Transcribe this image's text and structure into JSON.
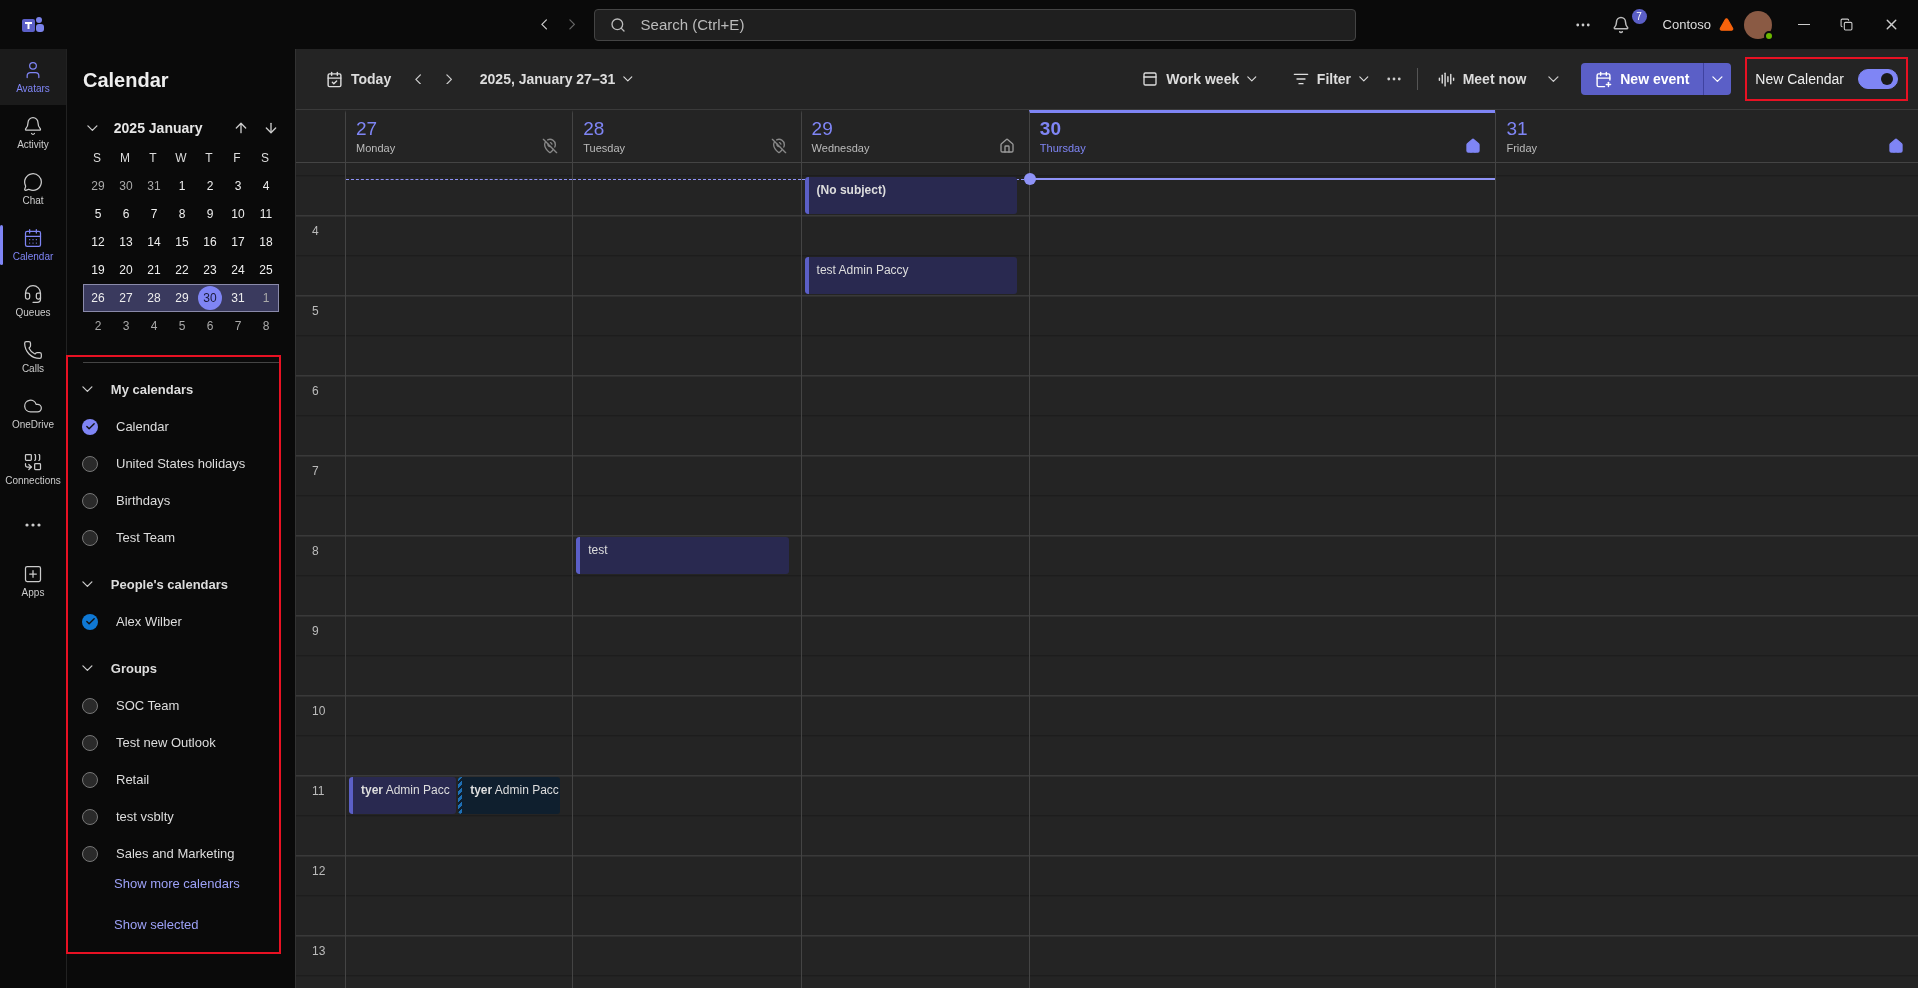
{
  "app_bar": {
    "search": {
      "placeholder": "Search (Ctrl+E)"
    },
    "notifications": {
      "badge": "7"
    },
    "org": "Contoso",
    "org_warning": true
  },
  "rail": [
    {
      "label": "Avatars",
      "selected": false,
      "highlighted": true
    },
    {
      "label": "Activity",
      "selected": false,
      "highlighted": false
    },
    {
      "label": "Chat",
      "selected": false,
      "highlighted": false
    },
    {
      "label": "Calendar",
      "selected": true,
      "highlighted": false
    },
    {
      "label": "Queues",
      "selected": false,
      "highlighted": false
    },
    {
      "label": "Calls",
      "selected": false,
      "highlighted": false
    },
    {
      "label": "OneDrive",
      "selected": false,
      "highlighted": false
    },
    {
      "label": "Connections",
      "selected": false,
      "highlighted": false
    },
    {
      "selected": false,
      "highlighted": false
    },
    {
      "label": "Apps",
      "selected": false,
      "highlighted": false
    }
  ],
  "calendar_panel": {
    "title": "Calendar",
    "month": {
      "label": "2025 January",
      "expanded": true,
      "weekdays": [
        "S",
        "M",
        "T",
        "W",
        "T",
        "F",
        "S"
      ],
      "weeks": [
        {
          "selected": false,
          "days": [
            {
              "d": "29",
              "muted": true,
              "today": false
            },
            {
              "d": "30",
              "muted": true,
              "today": false
            },
            {
              "d": "31",
              "muted": true,
              "today": false
            },
            {
              "d": "1",
              "muted": false,
              "today": false
            },
            {
              "d": "2",
              "muted": false,
              "today": false
            },
            {
              "d": "3",
              "muted": false,
              "today": false
            },
            {
              "d": "4",
              "muted": false,
              "today": false
            }
          ]
        },
        {
          "selected": false,
          "days": [
            {
              "d": "5",
              "muted": false,
              "today": false
            },
            {
              "d": "6",
              "muted": false,
              "today": false
            },
            {
              "d": "7",
              "muted": false,
              "today": false
            },
            {
              "d": "8",
              "muted": false,
              "today": false
            },
            {
              "d": "9",
              "muted": false,
              "today": false
            },
            {
              "d": "10",
              "muted": false,
              "today": false
            },
            {
              "d": "11",
              "muted": false,
              "today": false
            }
          ]
        },
        {
          "selected": false,
          "days": [
            {
              "d": "12",
              "muted": false,
              "today": false
            },
            {
              "d": "13",
              "muted": false,
              "today": false
            },
            {
              "d": "14",
              "muted": false,
              "today": false
            },
            {
              "d": "15",
              "muted": false,
              "today": false
            },
            {
              "d": "16",
              "muted": false,
              "today": false
            },
            {
              "d": "17",
              "muted": false,
              "today": false
            },
            {
              "d": "18",
              "muted": false,
              "today": false
            }
          ]
        },
        {
          "selected": false,
          "days": [
            {
              "d": "19",
              "muted": false,
              "today": false
            },
            {
              "d": "20",
              "muted": false,
              "today": false
            },
            {
              "d": "21",
              "muted": false,
              "today": false
            },
            {
              "d": "22",
              "muted": false,
              "today": false
            },
            {
              "d": "23",
              "muted": false,
              "today": false
            },
            {
              "d": "24",
              "muted": false,
              "today": false
            },
            {
              "d": "25",
              "muted": false,
              "today": false
            }
          ]
        },
        {
          "selected": true,
          "days": [
            {
              "d": "26",
              "muted": false,
              "today": false
            },
            {
              "d": "27",
              "muted": false,
              "today": false
            },
            {
              "d": "28",
              "muted": false,
              "today": false
            },
            {
              "d": "29",
              "muted": false,
              "today": false
            },
            {
              "d": "30",
              "muted": false,
              "today": true
            },
            {
              "d": "31",
              "muted": false,
              "today": false
            },
            {
              "d": "1",
              "muted": true,
              "today": false
            }
          ]
        },
        {
          "selected": false,
          "days": [
            {
              "d": "2",
              "muted": true,
              "today": false
            },
            {
              "d": "3",
              "muted": true,
              "today": false
            },
            {
              "d": "4",
              "muted": true,
              "today": false
            },
            {
              "d": "5",
              "muted": true,
              "today": false
            },
            {
              "d": "6",
              "muted": true,
              "today": false
            },
            {
              "d": "7",
              "muted": true,
              "today": false
            },
            {
              "d": "8",
              "muted": true,
              "today": false
            }
          ]
        }
      ]
    },
    "lists_highlighted": true,
    "groups": [
      {
        "name": "My calendars",
        "expanded": true,
        "items": [
          {
            "label": "Calendar",
            "checked": true,
            "color": "#7f85f5"
          },
          {
            "label": "United States holidays",
            "checked": false
          },
          {
            "label": "Birthdays",
            "checked": false
          },
          {
            "label": "Test Team",
            "checked": false
          }
        ]
      },
      {
        "name": "People's calendars",
        "expanded": true,
        "items": [
          {
            "label": "Alex Wilber",
            "checked": true,
            "color": "#0f78d4"
          }
        ]
      },
      {
        "name": "Groups",
        "expanded": true,
        "items": [
          {
            "label": "SOC Team",
            "checked": false
          },
          {
            "label": "Test new Outlook",
            "checked": false
          },
          {
            "label": "Retail",
            "checked": false
          },
          {
            "label": "test vsblty",
            "checked": false
          },
          {
            "label": "Sales and Marketing",
            "checked": false
          }
        ]
      }
    ],
    "links": [
      "Show more calendars",
      "Show selected"
    ]
  },
  "toolbar": {
    "today": "Today",
    "range": "2025, January 27–31",
    "view": "Work week",
    "filter": "Filter",
    "meet_now": "Meet now",
    "new_event": "New event",
    "new_calendar": {
      "label": "New Calendar",
      "on": true,
      "highlighted": true
    }
  },
  "days": [
    {
      "number": "27",
      "name": "Monday",
      "selected": false,
      "kind": "away"
    },
    {
      "number": "28",
      "name": "Tuesday",
      "selected": false,
      "kind": "away"
    },
    {
      "number": "29",
      "name": "Wednesday",
      "selected": false,
      "kind": "remote"
    },
    {
      "number": "30",
      "name": "Thursday",
      "selected": true,
      "kind": "home"
    },
    {
      "number": "31",
      "name": "Friday",
      "selected": false,
      "kind": "home"
    }
  ],
  "now_line": true,
  "rows": [
    {
      "cells": [
        {},
        {},
        {
          "events": [
            {
              "title": "**(No subject)**",
              "kind": "normal",
              "second_half": true
            }
          ]
        },
        {},
        {}
      ]
    },
    {
      "label": "4",
      "cells": [
        {},
        {},
        {
          "events": [
            {
              "title": "test Admin Paccy",
              "kind": "normal",
              "second_half": true
            }
          ]
        },
        {},
        {}
      ]
    },
    {
      "label": "5",
      "cells": [
        {},
        {},
        {},
        {},
        {}
      ]
    },
    {
      "label": "6",
      "cells": [
        {},
        {},
        {},
        {},
        {}
      ]
    },
    {
      "label": "7",
      "cells": [
        {},
        {},
        {},
        {},
        {}
      ]
    },
    {
      "label": "8",
      "cells": [
        {},
        {
          "events": [
            {
              "title": "test",
              "kind": "normal",
              "second_half": false
            }
          ]
        },
        {},
        {},
        {}
      ]
    },
    {
      "label": "9",
      "cells": [
        {},
        {},
        {},
        {},
        {}
      ]
    },
    {
      "label": "10",
      "cells": [
        {},
        {},
        {},
        {},
        {}
      ]
    },
    {
      "label": "11",
      "cells": [
        {
          "events": [
            {
              "title": "**tyer** Admin Pacc",
              "kind": "normal",
              "second_half": false
            },
            {
              "title": "**tyer** Admin Pacc",
              "kind": "shared",
              "second_half": false
            }
          ]
        },
        {},
        {},
        {},
        {}
      ]
    },
    {
      "label": "12",
      "cells": [
        {},
        {},
        {},
        {},
        {}
      ]
    },
    {
      "label": "13",
      "cells": [
        {},
        {},
        {},
        {},
        {}
      ]
    }
  ]
}
